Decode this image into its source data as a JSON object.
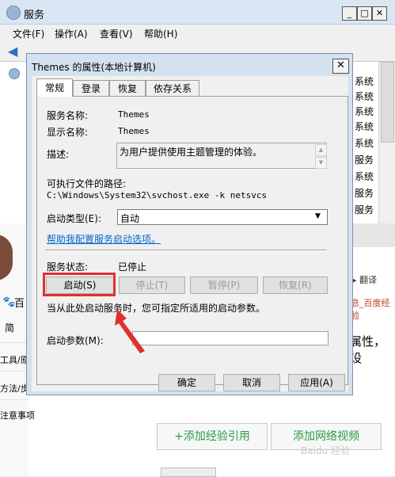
{
  "services_window": {
    "title": "服务",
    "menu": [
      "文件(F)",
      "操作(A)",
      "查看(V)",
      "帮助(H)"
    ],
    "list_status": [
      "系统",
      "系统",
      "系统",
      "系统",
      "系统",
      "服务",
      "系统",
      "服务",
      "服务"
    ]
  },
  "dialog": {
    "title": "Themes 的属性(本地计算机)",
    "tabs": [
      "常规",
      "登录",
      "恢复",
      "依存关系"
    ],
    "service_name_label": "服务名称:",
    "service_name": "Themes",
    "display_name_label": "显示名称:",
    "display_name": "Themes",
    "description_label": "描述:",
    "description": "为用户提供使用主题管理的体验。",
    "exe_path_label": "可执行文件的路径:",
    "exe_path": "C:\\Windows\\System32\\svchost.exe -k netsvcs",
    "startup_type_label": "启动类型(E):",
    "startup_type": "自动",
    "help_link": "帮助我配置服务启动选项。",
    "status_label": "服务状态:",
    "status": "已停止",
    "buttons": {
      "start": "启动(S)",
      "stop": "停止(T)",
      "pause": "暂停(P)",
      "resume": "恢复(R)"
    },
    "hint": "当从此处启动服务时，您可指定所适用的启动参数。",
    "params_label": "启动参数(M):",
    "footer": {
      "ok": "确定",
      "cancel": "取消",
      "apply": "应用(A)"
    }
  },
  "baidu_page": {
    "brand": "百",
    "tab": "简",
    "tools": "工具/原",
    "method": "方法/步",
    "note": "注意事项",
    "translate": "▶ 翻译",
    "link": "息_百度经验",
    "attr_text": "属性，设",
    "add_ref": "+添加经验引用",
    "add_video": "添加网络视频",
    "watermark": "Baidu 经验"
  },
  "colors": {
    "highlight": "#e03030",
    "link": "#0066cc",
    "green": "#2b9a45"
  }
}
